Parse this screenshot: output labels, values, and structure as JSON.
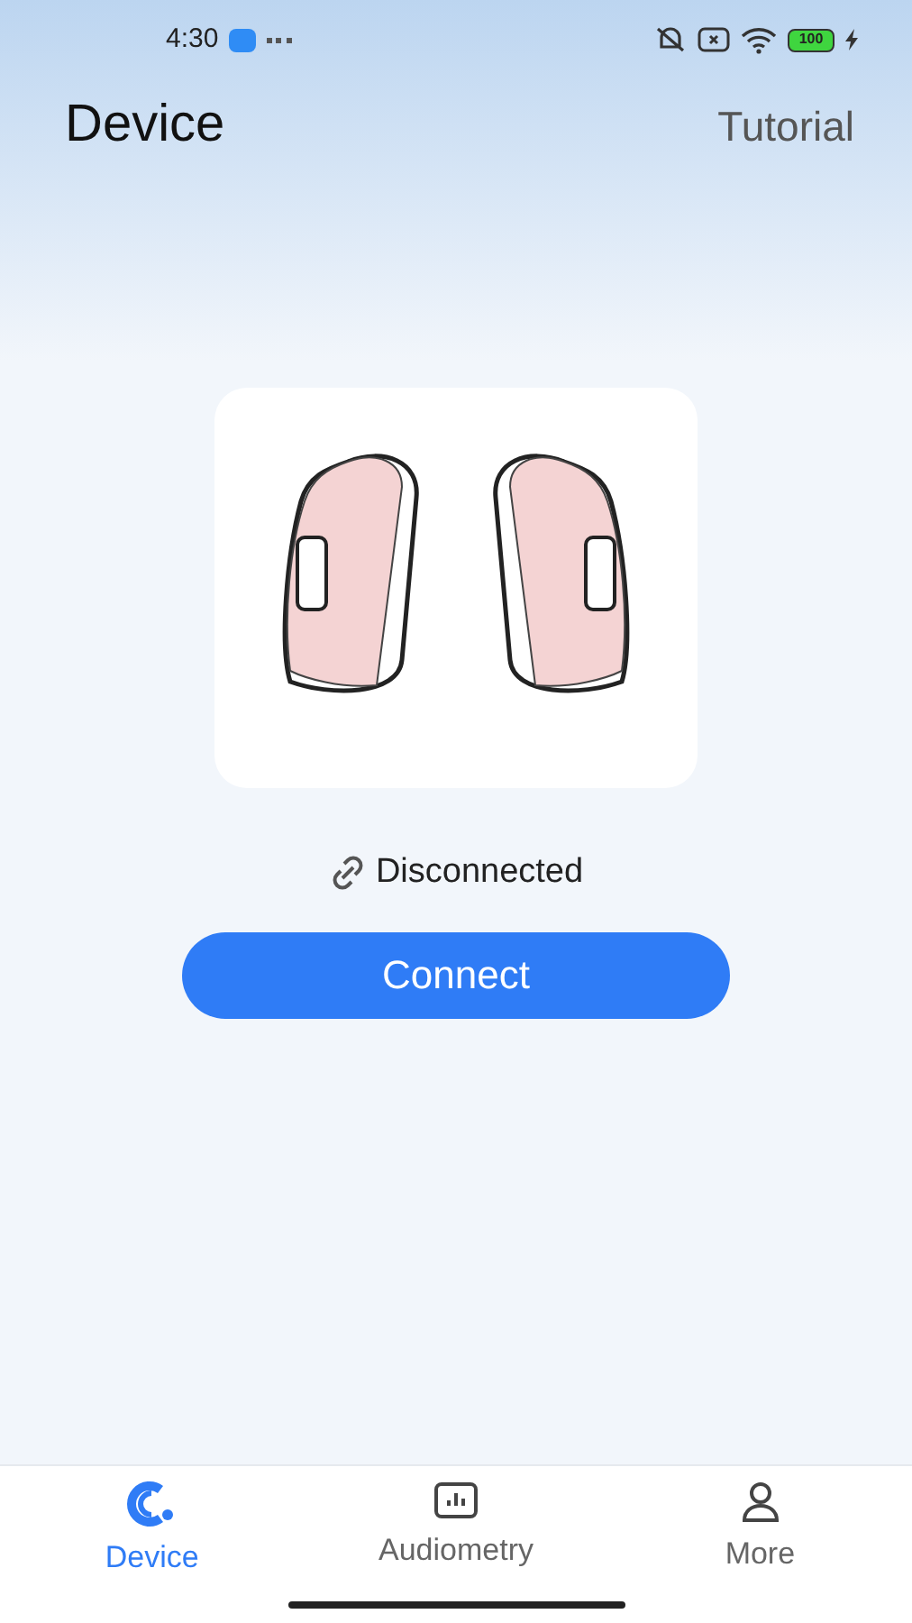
{
  "status_bar": {
    "time": "4:30",
    "battery": "100"
  },
  "header": {
    "title": "Device",
    "action": "Tutorial"
  },
  "connection": {
    "connected": false,
    "status": "Disconnected",
    "button": "Connect"
  },
  "tabs": [
    {
      "label": "Device",
      "selected": true
    },
    {
      "label": "Audiometry",
      "selected": false
    },
    {
      "label": "More",
      "selected": false
    }
  ]
}
